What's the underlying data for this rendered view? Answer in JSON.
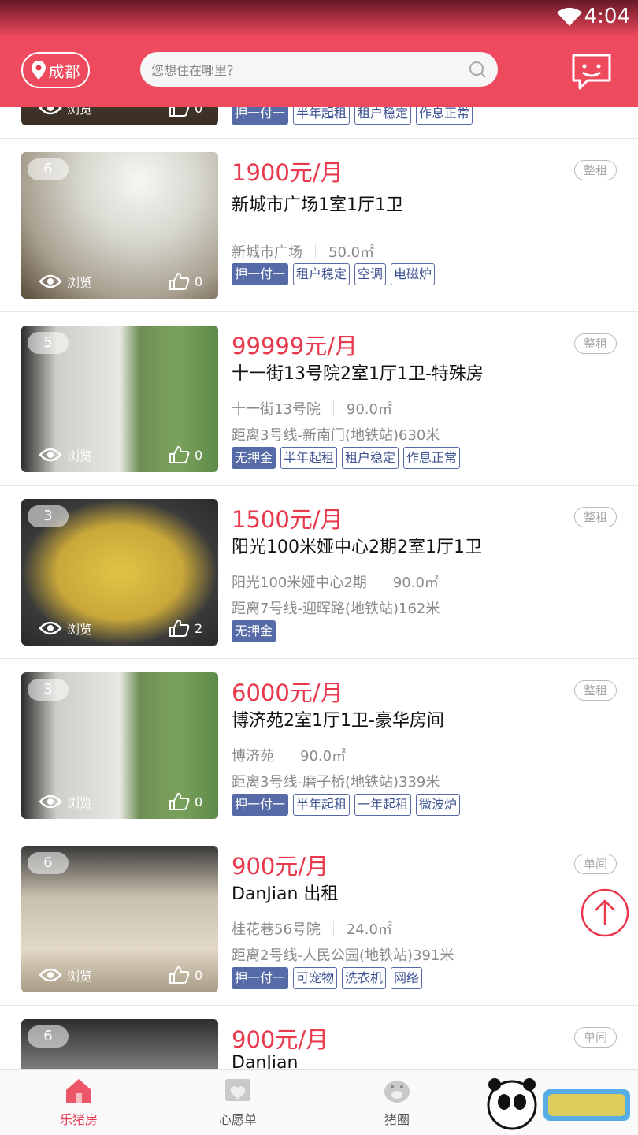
{
  "status": {
    "time": "4:04"
  },
  "header": {
    "city": "成都",
    "search_placeholder": "您想住在哪里？"
  },
  "listings": [
    {
      "price": "",
      "type": "",
      "title": "",
      "community": "",
      "area": "",
      "metro": "",
      "photo_count": "",
      "views_label": "浏览",
      "likes": "0",
      "tags": [
        {
          "label": "押一付一",
          "solid": true
        },
        {
          "label": "半年起租",
          "solid": false
        },
        {
          "label": "租户稳定",
          "solid": false
        },
        {
          "label": "作息正常",
          "solid": false
        }
      ]
    },
    {
      "price": "1900元/月",
      "type": "整租",
      "title": "新城市广场1室1厅1卫",
      "community": "新城市广场",
      "area": "50.0㎡",
      "metro": "",
      "photo_count": "6",
      "views_label": "浏览",
      "likes": "0",
      "tags": [
        {
          "label": "押一付一",
          "solid": true
        },
        {
          "label": "租户稳定",
          "solid": false
        },
        {
          "label": "空调",
          "solid": false
        },
        {
          "label": "电磁炉",
          "solid": false
        }
      ]
    },
    {
      "price": "99999元/月",
      "type": "整租",
      "title": "十一街13号院2室1厅1卫-特殊房",
      "community": "十一街13号院",
      "area": "90.0㎡",
      "metro": "距离3号线-新南门(地铁站)630米",
      "photo_count": "5",
      "views_label": "浏览",
      "likes": "0",
      "tags": [
        {
          "label": "无押金",
          "solid": true
        },
        {
          "label": "半年起租",
          "solid": false
        },
        {
          "label": "租户稳定",
          "solid": false
        },
        {
          "label": "作息正常",
          "solid": false
        }
      ]
    },
    {
      "price": "1500元/月",
      "type": "整租",
      "title": "阳光100米娅中心2期2室1厅1卫",
      "community": "阳光100米娅中心2期",
      "area": "90.0㎡",
      "metro": "距离7号线-迎晖路(地铁站)162米",
      "photo_count": "3",
      "views_label": "浏览",
      "likes": "2",
      "tags": [
        {
          "label": "无押金",
          "solid": true
        }
      ]
    },
    {
      "price": "6000元/月",
      "type": "整租",
      "title": "博济苑2室1厅1卫-豪华房间",
      "community": "博济苑",
      "area": "90.0㎡",
      "metro": "距离3号线-磨子桥(地铁站)339米",
      "photo_count": "3",
      "views_label": "浏览",
      "likes": "0",
      "tags": [
        {
          "label": "押一付一",
          "solid": true
        },
        {
          "label": "半年起租",
          "solid": false
        },
        {
          "label": "一年起租",
          "solid": false
        },
        {
          "label": "微波炉",
          "solid": false
        }
      ]
    },
    {
      "price": "900元/月",
      "type": "单间",
      "title": "DanJian 出租",
      "community": "桂花巷56号院",
      "area": "24.0㎡",
      "metro": "距离2号线-人民公园(地铁站)391米",
      "photo_count": "6",
      "views_label": "浏览",
      "likes": "0",
      "tags": [
        {
          "label": "押一付一",
          "solid": true
        },
        {
          "label": "可宠物",
          "solid": false
        },
        {
          "label": "洗衣机",
          "solid": false
        },
        {
          "label": "网络",
          "solid": false
        }
      ]
    },
    {
      "price": "900元/月",
      "type": "单间",
      "title": "DanJian",
      "community": "",
      "area": "",
      "metro": "",
      "photo_count": "6",
      "views_label": "",
      "likes": "",
      "tags": []
    }
  ],
  "nav": {
    "home": "乐猪房",
    "wishlist": "心愿单",
    "circle": "猪圈"
  },
  "colors": {
    "accent": "#e8394d",
    "tag_blue": "#556aa7"
  }
}
